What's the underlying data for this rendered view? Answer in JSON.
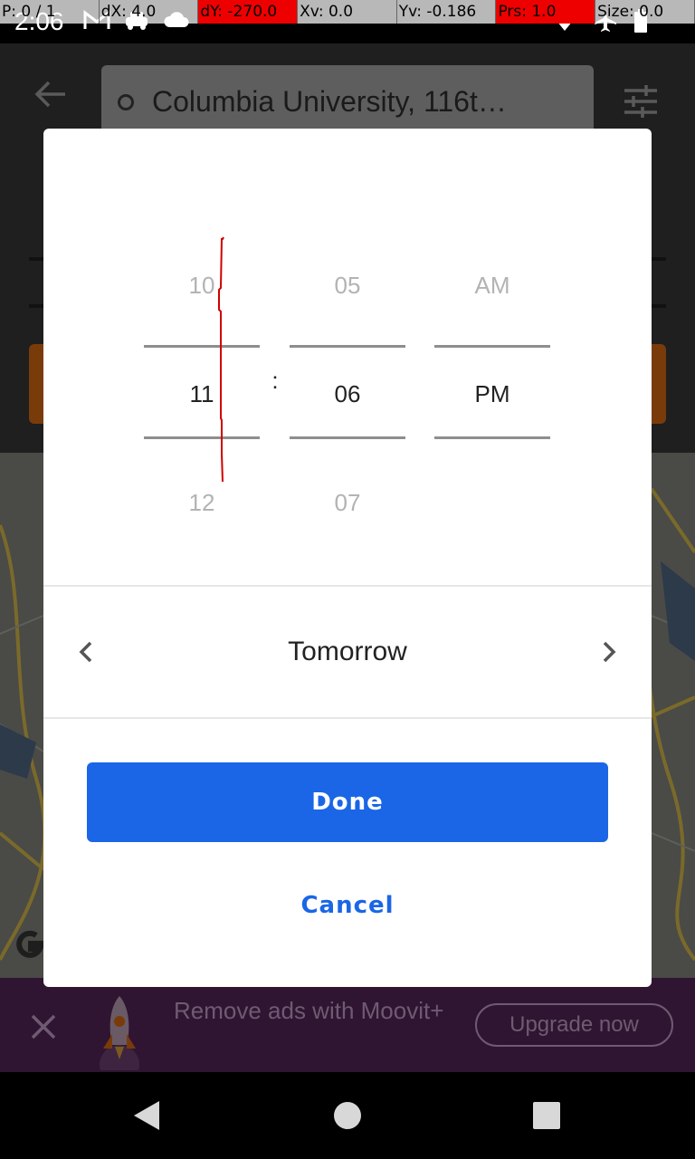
{
  "status_bar": {
    "time": "2:06",
    "debug": [
      "P: 0 / 1",
      "dX: 4.0",
      "dY: -270.0",
      "Xv: 0.0",
      "Yv: -0.186",
      "Prs: 1.0",
      "Size: 0.0"
    ],
    "icons": [
      "gmail-icon",
      "car-icon",
      "cloud-icon",
      "wifi-icon",
      "airplane-icon",
      "battery-icon"
    ]
  },
  "app": {
    "search_value": "Columbia University, 116t…",
    "ad": {
      "text": "Remove ads with Moovit+",
      "button": "Upgrade now"
    }
  },
  "dialog": {
    "hours": {
      "prev": "10",
      "selected": "11",
      "next": "12"
    },
    "separator": ":",
    "minutes": {
      "prev": "05",
      "selected": "06",
      "next": "07"
    },
    "period": {
      "prev": "AM",
      "selected": "PM"
    },
    "day": "Tomorrow",
    "done_label": "Done",
    "cancel_label": "Cancel"
  },
  "colors": {
    "accent": "#1a66e6",
    "scrim": "#000000"
  }
}
